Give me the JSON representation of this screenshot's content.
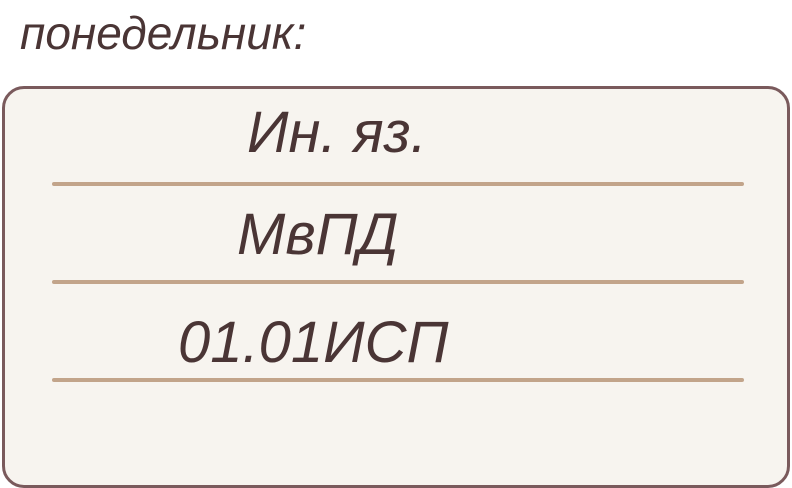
{
  "day": {
    "label": "понедельник:"
  },
  "schedule": {
    "lessons": [
      {
        "label": "Ин. яз."
      },
      {
        "label": "МвПД"
      },
      {
        "label": "01.01ИСП"
      }
    ]
  },
  "colors": {
    "text": "#4a3535",
    "card_background": "#f7f4ef",
    "card_border": "#7a5a5c",
    "line": "#c2a48a"
  }
}
